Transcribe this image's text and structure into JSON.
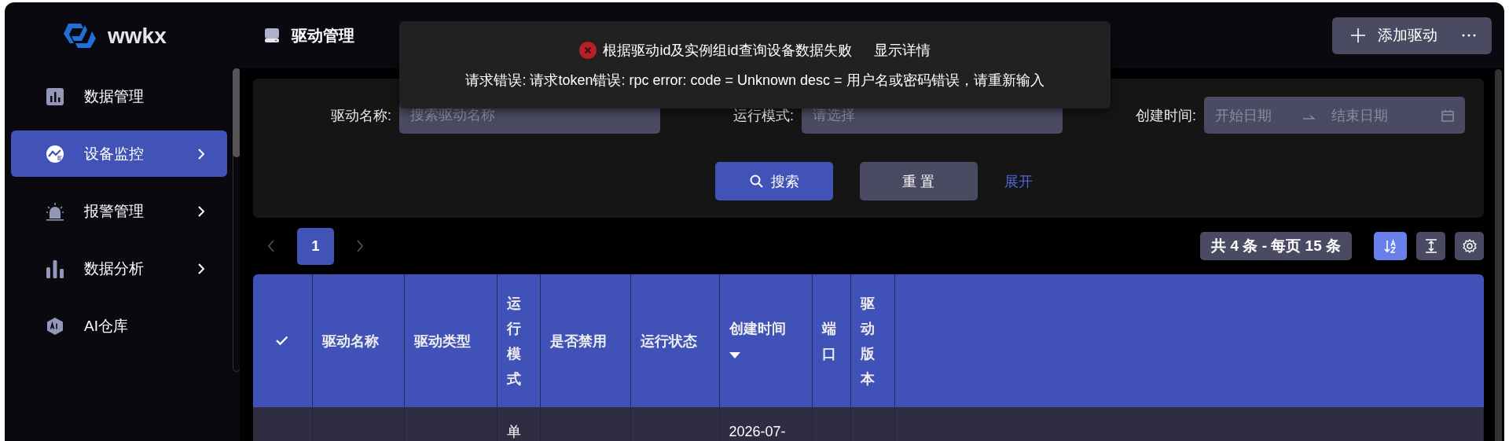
{
  "sidebar": {
    "logo_text": "wwkx",
    "items": [
      {
        "label": "数据管理",
        "kind": "report",
        "has_submenu": false,
        "selected": false
      },
      {
        "label": "设备监控",
        "kind": "monitor",
        "has_submenu": true,
        "selected": true
      },
      {
        "label": "报警管理",
        "kind": "alarm",
        "has_submenu": true,
        "selected": false
      },
      {
        "label": "数据分析",
        "kind": "bars",
        "has_submenu": true,
        "selected": false
      },
      {
        "label": "AI仓库",
        "kind": "ai",
        "has_submenu": false,
        "selected": false
      }
    ]
  },
  "page_header": {
    "title": "驱动管理",
    "add_button": "添加驱动"
  },
  "toast": {
    "message": "根据驱动id及实例组id查询设备数据失败",
    "detail_link": "显示详情",
    "description": "请求错误: 请求token错误: rpc error: code = Unknown desc = 用户名或密码错误，请重新输入"
  },
  "filters": [
    {
      "kind": "text",
      "label": "驱动名称:",
      "placeholder": "搜索驱动名称"
    },
    {
      "kind": "select",
      "label": "运行模式:",
      "placeholder": "请选择"
    },
    {
      "kind": "date_range",
      "label": "创建时间:",
      "start_placeholder": "开始日期",
      "end_placeholder": "结束日期"
    }
  ],
  "actions": {
    "search": "搜索",
    "reset": "重 置",
    "expand": "展开"
  },
  "pagination": {
    "pages": [
      {
        "label": "1",
        "selected": true
      }
    ],
    "summary": "共 4 条 - 每页 15 条"
  },
  "tools": [
    {
      "kind": "sort",
      "active": true
    },
    {
      "kind": "row_height",
      "active": false
    },
    {
      "kind": "settings",
      "active": false
    }
  ],
  "table": {
    "columns": [
      {
        "kind": "select_all"
      },
      {
        "label": "驱动名称",
        "sorted_descending": false
      },
      {
        "label": "驱动类型",
        "sorted_descending": false
      },
      {
        "label": "运行模式",
        "sorted_descending": false
      },
      {
        "label": "是否禁用",
        "sorted_descending": false
      },
      {
        "label": "运行状态",
        "sorted_descending": false
      },
      {
        "label": "创建时间",
        "sorted_descending": true
      },
      {
        "label": "端口",
        "sorted_descending": false
      },
      {
        "label": "驱动版本",
        "sorted_descending": false
      },
      {
        "kind": "filler"
      }
    ],
    "rows": [
      {
        "cells": [
          null,
          null,
          null,
          "单",
          null,
          null,
          "2026-07-",
          null,
          null,
          null
        ]
      }
    ]
  }
}
